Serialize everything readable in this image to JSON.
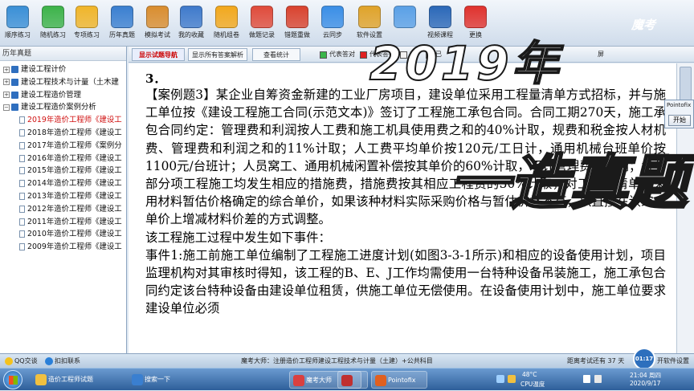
{
  "toolbar": {
    "buttons": [
      {
        "label": "顺序练习",
        "icon": "sequence-icon",
        "color": "#3a8fd6"
      },
      {
        "label": "随机练习",
        "icon": "random-icon",
        "color": "#3db34a"
      },
      {
        "label": "专项练习",
        "icon": "folder-icon",
        "color": "#f0b52a"
      },
      {
        "label": "历年真题",
        "icon": "history-icon",
        "color": "#3a7fd0"
      },
      {
        "label": "模拟考试",
        "icon": "exam-icon",
        "color": "#d98d2f"
      },
      {
        "label": "我的收藏",
        "icon": "favorites-icon",
        "color": "#3f7acb"
      },
      {
        "label": "随机组卷",
        "icon": "flower-icon",
        "color": "#f2a81d"
      },
      {
        "label": "做题记录",
        "icon": "calendar-icon",
        "color": "#e04b3b"
      },
      {
        "label": "错题重做",
        "icon": "calendar-redo-icon",
        "color": "#d9432f"
      },
      {
        "label": "云同步",
        "icon": "cloud-sync-icon",
        "color": "#3a8ee6"
      },
      {
        "label": "软件设置",
        "icon": "lock-icon",
        "color": "#e0a32a"
      },
      {
        "label": "",
        "icon": "help-icon",
        "color": "#5aa0e6"
      },
      {
        "label": "视频课程",
        "icon": "video-icon",
        "color": "#2b68b8"
      },
      {
        "label": "更换",
        "icon": "switch-icon",
        "color": "#e0322e"
      }
    ]
  },
  "left_panel": {
    "title": "历年真题",
    "tree": [
      {
        "label": "建设工程计价",
        "level": 0,
        "expanded": false
      },
      {
        "label": "建设工程技术与计量（土木建",
        "level": 0,
        "expanded": false
      },
      {
        "label": "建设工程造价管理",
        "level": 0,
        "expanded": false
      },
      {
        "label": "建设工程造价案例分析",
        "level": 0,
        "expanded": true
      },
      {
        "label": "2019年造价工程师《建设工",
        "level": 1,
        "selected": true
      },
      {
        "label": "2018年造价工程师《建设工",
        "level": 1
      },
      {
        "label": "2017年造价工程师《案例分",
        "level": 1
      },
      {
        "label": "2016年造价工程师《建设工",
        "level": 1
      },
      {
        "label": "2015年造价工程师《建设工",
        "level": 1
      },
      {
        "label": "2014年造价工程师《建设工",
        "level": 1
      },
      {
        "label": "2013年造价工程师《建设工",
        "level": 1
      },
      {
        "label": "2012年造价工程师《建设工",
        "level": 1
      },
      {
        "label": "2011年造价工程师《建设工",
        "level": 1
      },
      {
        "label": "2010年造价工程师《建设工",
        "level": 1
      },
      {
        "label": "2009年造价工程师《建设工",
        "level": 1
      }
    ]
  },
  "tabbar": {
    "tab_nav": "显示试题导航",
    "tab_answers": "显示所有答案解析",
    "tab_stats": "查看统计",
    "legend_correct": "代表答对",
    "legend_wrong": "代表答错",
    "legend_extra_a": "它",
    "legend_extra_b": "已",
    "legend_extra_c": "打",
    "legend_extra_d": "屏",
    "colors": {
      "correct": "#39b54a",
      "wrong": "#e02020",
      "neutral": "#f2f2f2"
    }
  },
  "question": {
    "number": "3．",
    "paragraphs": [
      "【案例题3】某企业自筹资金新建的工业厂房项目，建设单位采用工程量清单方式招标，并与施工单位按《建设工程施工合同(示范文本)》签订了工程施工承包合同。合同工期270天，施工承包合同约定：管理费和利润按人工费和施工机具使用费之和的40%计取，规费和税金按人材机费、管理费和利润之和的11%计取；人工费平均单价按120元/工日计，通用机械台班单价按1100元/台班计；人员窝工、通用机械闲置补偿按其单价的60%计取，不计管理费和利润；各分部分项工程施工均发生相应的措施费，措施费按其相应工程费的30%计取，对工程量清单中采用材料暂估价格确定的综合单价，如果该种材料实际采购价格与暂估价格不符，以直接在该综合单价上增减材料价差的方式调整。",
      "该工程施工过程中发生如下事件：",
      "事件1:施工前施工单位编制了工程施工进度计划(如图3-3-1所示)和相应的设备使用计划，项目监理机构对其审核时得知，该工程的B、E、J工作均需使用一台特种设备吊装施工，施工承包合同约定该台特种设备由建设单位租赁，供施工单位无偿使用。在设备使用计划中，施工单位要求建设单位必须"
    ]
  },
  "watermark": {
    "year": "2019年",
    "title": "一造真题",
    "brand": "魔考"
  },
  "mini_window": {
    "title": "Pointofix",
    "button": "开始"
  },
  "status_bar": {
    "left_a": "QQ交谈",
    "left_b": "扣扣联系",
    "center": "魔考大师：注册造价工程师建设工程技术与计量（土建）+公共科目",
    "right_a": "距离考试还有 37 天",
    "timer": "01:17",
    "right_b": "开软件设置"
  },
  "taskbar": {
    "tasks": [
      {
        "label": "造价工程师试题",
        "icon": "folder-icon",
        "color": "#f0c040"
      },
      {
        "label": "搜索一下",
        "icon": "search-icon",
        "color": "#3a7fd0"
      },
      {
        "label": "魔考大师",
        "icon": "app-icon",
        "color": "#d94040"
      },
      {
        "label": "",
        "icon": "app-icon",
        "color": "#c03030"
      },
      {
        "label": "Pointofix",
        "icon": "pointofix-icon",
        "color": "#e06020"
      }
    ],
    "temp": "48°C",
    "temp_label": "CPU温度",
    "time": "21:04 周四",
    "date": "2020/9/17"
  }
}
